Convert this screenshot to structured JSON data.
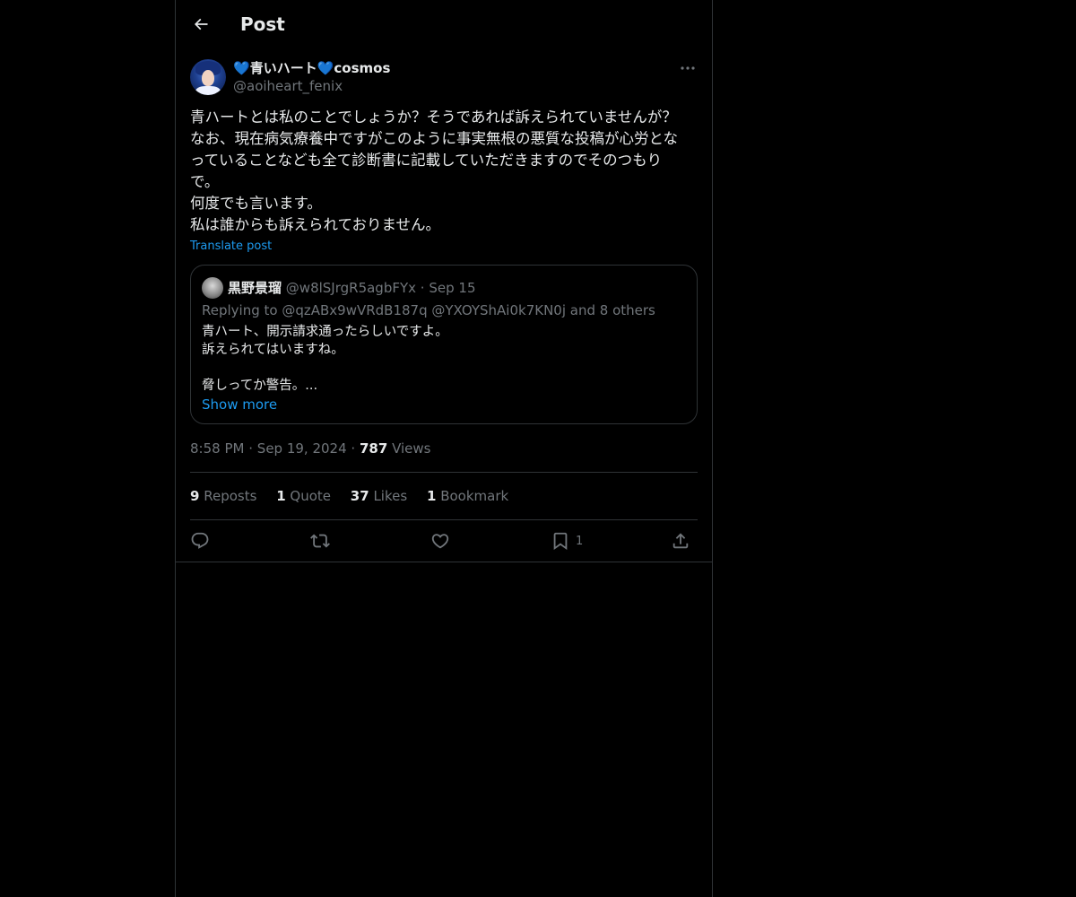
{
  "header": {
    "title": "Post",
    "back_icon": "arrow-left-icon"
  },
  "author": {
    "name_prefix_heart": "💙",
    "name_text": "青いハート",
    "name_suffix_heart": "💙",
    "name_tail": "cosmos",
    "handle": "@aoiheart_fenix",
    "more_icon": "more-horizontal-icon"
  },
  "post": {
    "text": "青ハートとは私のことでしょうか？そうであれば訴えられていませんが？\nなお、現在病気療養中ですがこのように事実無根の悪質な投稿が心労とな\nっていることなども全て診断書に記載していただきますのでそのつもり\nで。\n何度でも言います。\n私は誰からも訴えられておりません。",
    "translate_label": "Translate post"
  },
  "quote": {
    "name": "黒野景瑠",
    "handle": "@w8lSJrgR5agbFYx",
    "separator": "·",
    "date": "Sep 15",
    "replying": "Replying to @qzABx9wVRdB187q @YXOYShAi0k7KN0j and 8 others",
    "text": "青ハート、開示請求通ったらしいですよ。\n訴えられてはいますね。\n\n脅しってか警告。...",
    "show_more": "Show more"
  },
  "meta": {
    "time": "8:58 PM",
    "sep1": "·",
    "date": "Sep 19, 2024",
    "sep2": "·",
    "views_count": "787",
    "views_label": "Views"
  },
  "stats": {
    "reposts_count": "9",
    "reposts_label": "Reposts",
    "quote_count": "1",
    "quote_label": "Quote",
    "likes_count": "37",
    "likes_label": "Likes",
    "bookmark_count": "1",
    "bookmark_label": "Bookmark"
  },
  "actions": {
    "reply_icon": "reply-icon",
    "repost_icon": "repost-icon",
    "like_icon": "heart-icon",
    "bookmark_icon": "bookmark-icon",
    "bookmark_count": "1",
    "share_icon": "share-icon"
  },
  "colors": {
    "background": "#000000",
    "text": "#e7e9ea",
    "muted": "#71767b",
    "link": "#1d9bf0",
    "border": "#2f3336"
  }
}
